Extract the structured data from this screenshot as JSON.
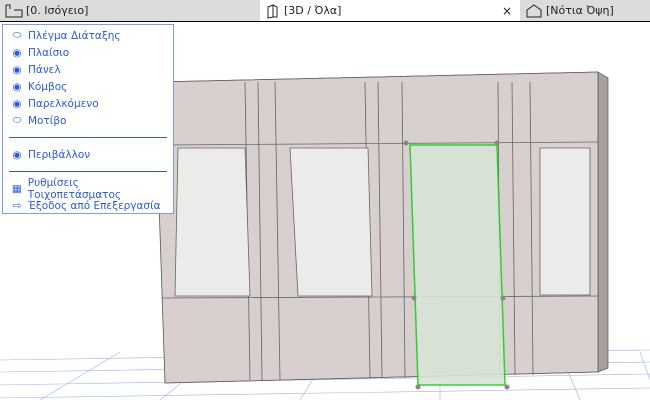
{
  "tabs": [
    {
      "label": "[0. Ισόγειο]",
      "icon": "floor-plan-icon",
      "active": false
    },
    {
      "label": "[3D / Όλα]",
      "icon": "3d-box-icon",
      "active": true,
      "close": "×"
    },
    {
      "label": "[Νότια Όψη]",
      "icon": "elevation-icon",
      "active": false
    }
  ],
  "menu": {
    "items": [
      {
        "label": "Πλέγμα Διάταξης",
        "icon": "eye-closed-icon"
      },
      {
        "label": "Πλαίσιο",
        "icon": "eye-icon"
      },
      {
        "label": "Πάνελ",
        "icon": "eye-icon"
      },
      {
        "label": "Κόμβος",
        "icon": "eye-icon"
      },
      {
        "label": "Παρελκόμενο",
        "icon": "eye-icon"
      },
      {
        "label": "Μοτίβο",
        "icon": "eye-closed-icon"
      }
    ],
    "env": {
      "label": "Περιβάλλον",
      "icon": "eye-icon"
    },
    "settings": {
      "label": "Ρυθμίσεις Τοιχοπετάσματος",
      "icon": "curtain-wall-settings-icon"
    },
    "exit": {
      "label": "Έξοδος από Επεξεργασία",
      "icon": "exit-icon"
    }
  },
  "colors": {
    "accent": "#2a5bd7",
    "selection": "#22cc22",
    "wall": "#d8cfcf"
  }
}
